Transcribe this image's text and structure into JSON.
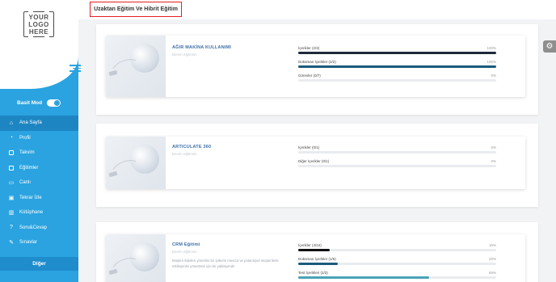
{
  "logo": {
    "lines": [
      "YOUR",
      "LOGO",
      "HERE"
    ]
  },
  "sidebar": {
    "mode_label": "Basit Mod",
    "items": [
      {
        "label": "Ana Sayfa",
        "icon": "home-icon",
        "active": true
      },
      {
        "label": "Profil",
        "icon": "user-icon"
      },
      {
        "label": "Takvim",
        "icon": "calendar-icon"
      },
      {
        "label": "Eğitimler",
        "icon": "book-icon"
      },
      {
        "label": "Canlı",
        "icon": "video-icon"
      },
      {
        "label": "Tekrar İzle",
        "icon": "replay-icon"
      },
      {
        "label": "Kütüphane",
        "icon": "library-icon"
      },
      {
        "label": "Soru&Cevap",
        "icon": "question-icon"
      },
      {
        "label": "Sınavlar",
        "icon": "exam-icon"
      }
    ],
    "bottom_label": "Diğer"
  },
  "header": {
    "title": "Uzaktan Eğitim Ve Hibrit Eğitim"
  },
  "courses": [
    {
      "name": "AĞIR MAKİNA KULLANIMI",
      "subtitle": "Benim eğitimim",
      "progress": [
        {
          "label": "İçerikler (2/3)",
          "pct_label": "100%",
          "value": 100,
          "color": "#1c2a3a"
        },
        {
          "label": "Doküman İçerikler (2/2)",
          "pct_label": "100%",
          "value": 100,
          "color": "#1d5a7c"
        },
        {
          "label": "Görevler (0/7)",
          "pct_label": "0%",
          "value": 0,
          "color": "#1d5a7c"
        }
      ]
    },
    {
      "name": "ARTICULATE 360",
      "subtitle": "Benim eğitimim",
      "progress": [
        {
          "label": "İçerikler (0/1)",
          "pct_label": "0%",
          "value": 0,
          "color": "#1c2a3a"
        },
        {
          "label": "Diğer İçerikler (0/1)",
          "pct_label": "0%",
          "value": 0,
          "color": "#1c2a3a"
        }
      ]
    },
    {
      "name": "CRM Eğitimi",
      "subtitle": "Benim eğitimim",
      "description": "Müşteri ilişkileri yönetimi bir şirketin mevcut ve potansiyel müşterilerle etkileşimini yönetmek için bir yaklaşımdır",
      "progress": [
        {
          "label": "İçerikler (4/24)",
          "pct_label": "16%",
          "value": 16,
          "color": "#111111"
        },
        {
          "label": "Doküman İçerikler (1/5)",
          "pct_label": "20%",
          "value": 20,
          "color": "#1d5a7c"
        },
        {
          "label": "Test İçerikleri (2/3)",
          "pct_label": "66%",
          "value": 66,
          "color": "#4aa3b8"
        }
      ]
    }
  ]
}
